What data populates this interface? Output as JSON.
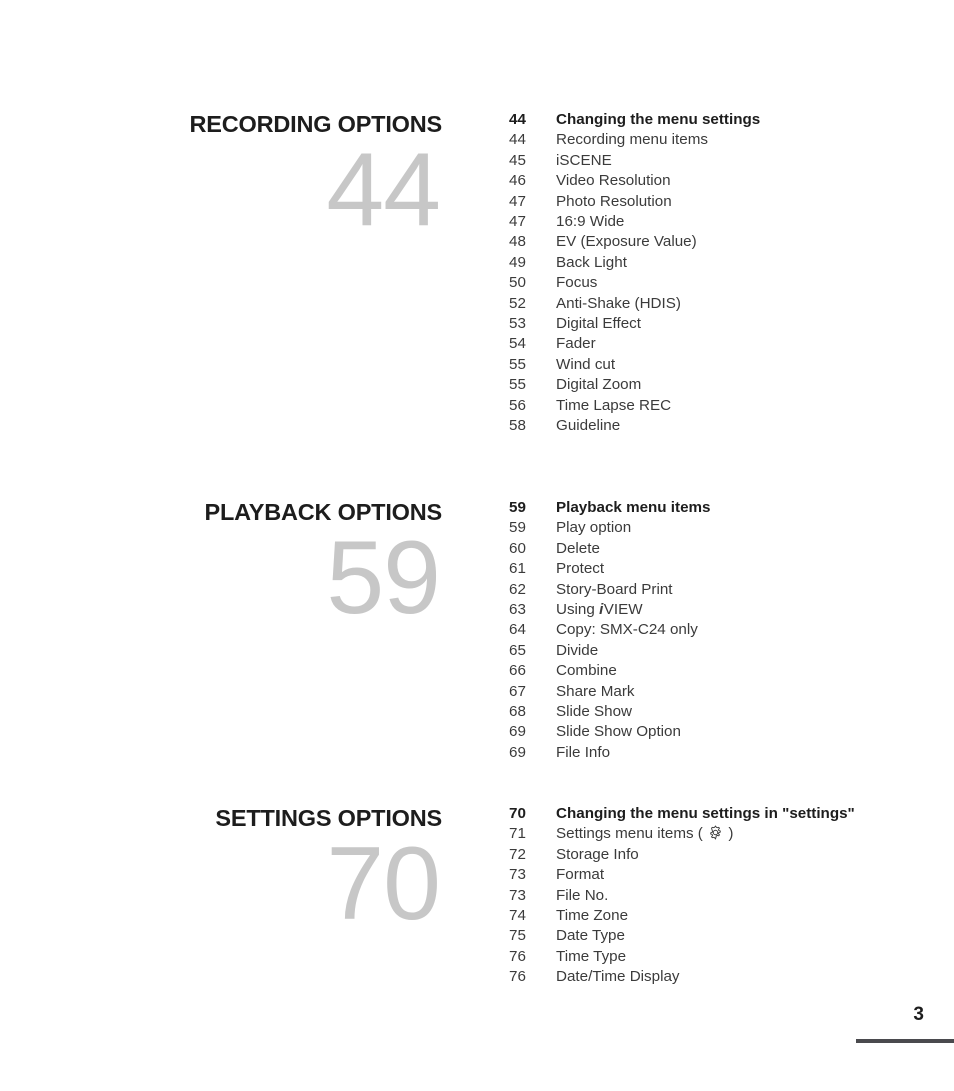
{
  "document": {
    "kind": "table-of-contents",
    "folio": "3"
  },
  "sections": [
    {
      "title": "RECORDING OPTIONS",
      "big_number": "44",
      "entries": [
        {
          "page": "44",
          "label": "Changing the menu settings",
          "bold": true
        },
        {
          "page": "44",
          "label": "Recording menu items",
          "bold": false
        },
        {
          "page": "45",
          "label": "iSCENE",
          "bold": false
        },
        {
          "page": "46",
          "label": "Video Resolution",
          "bold": false
        },
        {
          "page": "47",
          "label": "Photo Resolution",
          "bold": false
        },
        {
          "page": "47",
          "label": "16:9 Wide",
          "bold": false
        },
        {
          "page": "48",
          "label": "EV (Exposure Value)",
          "bold": false
        },
        {
          "page": "49",
          "label": "Back Light",
          "bold": false
        },
        {
          "page": "50",
          "label": "Focus",
          "bold": false
        },
        {
          "page": "52",
          "label": "Anti-Shake (HDIS)",
          "bold": false
        },
        {
          "page": "53",
          "label": "Digital Effect",
          "bold": false
        },
        {
          "page": "54",
          "label": "Fader",
          "bold": false
        },
        {
          "page": "55",
          "label": "Wind cut",
          "bold": false
        },
        {
          "page": "55",
          "label": "Digital Zoom",
          "bold": false
        },
        {
          "page": "56",
          "label": "Time Lapse REC",
          "bold": false
        },
        {
          "page": "58",
          "label": "Guideline",
          "bold": false
        }
      ]
    },
    {
      "title": "PLAYBACK OPTIONS",
      "big_number": "59",
      "entries": [
        {
          "page": "59",
          "label": "Playback menu items",
          "bold": true
        },
        {
          "page": "59",
          "label": "Play option",
          "bold": false
        },
        {
          "page": "60",
          "label": "Delete",
          "bold": false
        },
        {
          "page": "61",
          "label": "Protect",
          "bold": false
        },
        {
          "page": "62",
          "label": "Story-Board Print",
          "bold": false
        },
        {
          "page": "63",
          "label": "Using iVIEW",
          "bold": false,
          "brand_i": true,
          "prefix": "Using ",
          "suffix": "VIEW"
        },
        {
          "page": "64",
          "label": "Copy: SMX-C24 only",
          "bold": false
        },
        {
          "page": "65",
          "label": "Divide",
          "bold": false
        },
        {
          "page": "66",
          "label": "Combine",
          "bold": false
        },
        {
          "page": "67",
          "label": "Share Mark",
          "bold": false
        },
        {
          "page": "68",
          "label": "Slide Show",
          "bold": false
        },
        {
          "page": "69",
          "label": "Slide Show Option",
          "bold": false
        },
        {
          "page": "69",
          "label": "File Info",
          "bold": false
        }
      ]
    },
    {
      "title": "SETTINGS OPTIONS",
      "big_number": "70",
      "entries": [
        {
          "page": "70",
          "label": "Changing the menu settings in \"settings\"",
          "bold": true
        },
        {
          "page": "71",
          "label": "Settings menu items (  )",
          "bold": false,
          "gear": true,
          "prefix": "Settings menu items ( ",
          "suffix": " )"
        },
        {
          "page": "72",
          "label": "Storage Info",
          "bold": false
        },
        {
          "page": "73",
          "label": "Format",
          "bold": false
        },
        {
          "page": "73",
          "label": "File No.",
          "bold": false
        },
        {
          "page": "74",
          "label": "Time Zone",
          "bold": false
        },
        {
          "page": "75",
          "label": "Date Type",
          "bold": false
        },
        {
          "page": "76",
          "label": "Time Type",
          "bold": false
        },
        {
          "page": "76",
          "label": "Date/Time Display",
          "bold": false
        }
      ]
    }
  ],
  "icons": {
    "gear": "gear-icon"
  },
  "colors": {
    "heading": "#1d1d1d",
    "body": "#3b3b3b",
    "watermark": "#c7c7c7",
    "rule": "#4a4a4e",
    "background": "#ffffff"
  }
}
